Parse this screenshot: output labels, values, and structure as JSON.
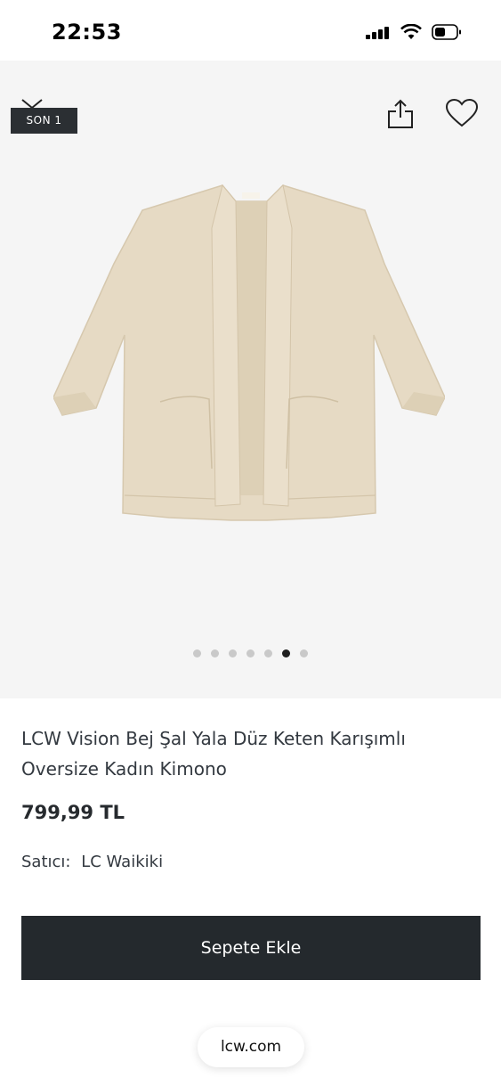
{
  "status_bar": {
    "time": "22:53"
  },
  "gallery": {
    "badge": "SON 1",
    "dots_total": 7,
    "active_dot": 6
  },
  "product": {
    "title": "LCW Vision Bej Şal Yala Düz Keten Karışımlı Oversize Kadın Kimono",
    "price": "799,99 TL",
    "seller_label": "Satıcı:",
    "seller_name": "LC Waikiki"
  },
  "actions": {
    "add_to_cart": "Sepete Ekle"
  },
  "browser": {
    "url": "lcw.com"
  },
  "colors": {
    "button_bg": "#24292d",
    "gallery_bg": "#f5f5f5",
    "kimono": "#e6dac4"
  }
}
